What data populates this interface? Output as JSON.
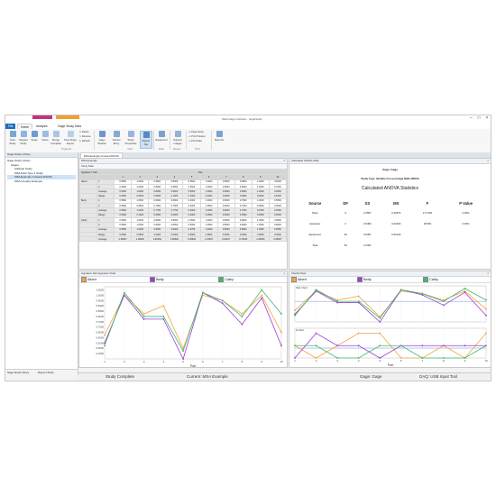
{
  "window": {
    "title": "Multi-Gage Interface - GageStudy",
    "context_tabs": [
      "",
      ""
    ],
    "tabs": [
      {
        "label": "File"
      },
      {
        "label": "Home"
      },
      {
        "label": "Analysis"
      },
      {
        "label": "Gage Study Data"
      }
    ]
  },
  "ribbon": {
    "buttons": [
      "New Study",
      "Repeat Study",
      "Study",
      "Clone",
      "Merge Complete",
      "New Study Export",
      "Gage Studies",
      "Cancel Entry",
      "Study Properties",
      "Report Set",
      "Equipment",
      "Support Images",
      "Reports"
    ],
    "small_items": [
      "Delete",
      "Rename",
      "Refresh",
      "Page Setup",
      "Print Preview",
      "Print Data"
    ],
    "groups": [
      "Organize",
      "View",
      "Data",
      "Report",
      "Print"
    ]
  },
  "sidebar": {
    "header": "Gage Study Library",
    "items": [
      "Study Library",
      "Group By",
      "Sort"
    ],
    "tree": [
      "Gage Study Library",
      "Gages",
      "Attribute Study",
      "MSA Data Type 1 Study",
      "MSA Example Crossed ANOVA",
      "MSA Linearity Example"
    ],
    "bottom_tabs": [
      "Gage Study Library",
      "Report Library"
    ]
  },
  "document": {
    "tabs": [
      "MSA Example Crossed ANOVA"
    ],
    "subtab": "MSA Example"
  },
  "study_data": {
    "header": "Study Data",
    "columns": [
      "Appraiser / Trial",
      "1",
      "2",
      "3",
      "4",
      "5",
      "6",
      "7",
      "8",
      "9",
      "10"
    ],
    "parts_label": "Part",
    "rows": [
      {
        "a": "Albert",
        "t": "1",
        "v": [
          "0.6500",
          "1.0000",
          "0.8500",
          "0.8500",
          "0.5500",
          "1.0000",
          "0.9500",
          "0.8500",
          "1.0000",
          "0.6000"
        ]
      },
      {
        "a": "",
        "t": "2",
        "v": [
          "0.6000",
          "1.0000",
          "0.8000",
          "0.9500",
          "0.4500",
          "1.0000",
          "0.9500",
          "0.8000",
          "1.0000",
          "0.7000"
        ]
      },
      {
        "a": "",
        "t": "Average",
        "v": [
          "0.6250",
          "1.0000",
          "0.8250",
          "0.9000",
          "0.5000",
          "1.0000",
          "0.9500",
          "0.8250",
          "1.0000",
          "0.6500"
        ]
      },
      {
        "a": "",
        "t": "Range",
        "v": [
          "0.0500",
          "0.0000",
          "0.0500",
          "0.1000",
          "0.1000",
          "0.0000",
          "0.0000",
          "0.0500",
          "0.0000",
          "0.1000"
        ]
      },
      {
        "a": "Betty",
        "t": "1",
        "v": [
          "0.5500",
          "1.0500",
          "0.8000",
          "0.8000",
          "0.4000",
          "1.0000",
          "0.9500",
          "0.7500",
          "1.0000",
          "0.5500"
        ]
      },
      {
        "a": "",
        "t": "2",
        "v": [
          "0.5500",
          "0.9500",
          "0.7500",
          "0.7500",
          "0.4000",
          "1.0500",
          "0.9000",
          "0.7000",
          "0.9500",
          "0.5000"
        ]
      },
      {
        "a": "",
        "t": "Average",
        "v": [
          "0.5500",
          "1.0000",
          "0.7750",
          "0.7750",
          "0.4000",
          "1.0250",
          "0.9250",
          "0.7250",
          "0.9750",
          "0.5250"
        ]
      },
      {
        "a": "",
        "t": "Range",
        "v": [
          "0.0000",
          "0.1000",
          "0.0500",
          "0.0500",
          "0.0000",
          "0.0500",
          "0.0500",
          "0.0500",
          "0.0500",
          "0.0500"
        ]
      },
      {
        "a": "Cathy",
        "t": "1",
        "v": [
          "0.5000",
          "1.0500",
          "0.8000",
          "0.8000",
          "0.4500",
          "1.0000",
          "0.9500",
          "0.8000",
          "1.0500",
          "0.8500"
        ]
      },
      {
        "a": "",
        "t": "2",
        "v": [
          "0.5500",
          "1.0000",
          "0.8000",
          "0.8000",
          "0.5000",
          "1.0500",
          "0.9500",
          "0.8000",
          "1.0500",
          "0.8000"
        ]
      },
      {
        "a": "",
        "t": "Average",
        "v": [
          "0.5250",
          "1.0250",
          "0.8000",
          "0.8000",
          "0.4750",
          "1.0250",
          "0.9500",
          "0.8000",
          "1.0500",
          "0.8250"
        ]
      },
      {
        "a": "",
        "t": "Range",
        "v": [
          "0.0500",
          "0.0500",
          "0.0000",
          "0.0000",
          "0.0500",
          "0.0500",
          "0.0000",
          "0.0000",
          "0.0000",
          "0.0500"
        ]
      },
      {
        "a": "",
        "t": "Average",
        "v": [
          "0.56667",
          "1.00833",
          "0.80000",
          "0.82500",
          "0.45833",
          "1.01667",
          "0.94167",
          "0.78333",
          "1.00833",
          "0.66667"
        ]
      }
    ]
  },
  "anova": {
    "header": "Calculated ANOVA Table",
    "gage_line": "Gage: Gage",
    "study_type": "Study Type: Variable Crossed Gage R&R ANOVA",
    "heading": "Calculated ANOVA Statistics",
    "columns": [
      "Source",
      "DF",
      "SS",
      "MS",
      "F",
      "P Value"
    ],
    "rows": [
      [
        "Parts",
        "9",
        "2.0587",
        "0.22875",
        "177.093",
        "0.00%"
      ],
      [
        "Appraiser",
        "2",
        "0.0480",
        "0.02400",
        "18.581",
        "0.00%"
      ],
      [
        "Equipment",
        "30",
        "0.0387",
        "0.00129",
        "",
        ""
      ],
      [
        "Total",
        "59",
        "2.2451",
        "",
        "",
        ""
      ]
    ]
  },
  "legend": [
    "Albert",
    "Betty",
    "Cathy"
  ],
  "colors": {
    "albert": "#f3a541",
    "betty": "#9b3fd1",
    "cathy": "#3fb86c",
    "blue": "#6f8fe0",
    "accent": "#1e6fb8"
  },
  "chart_left": {
    "header": "Appraiser Part Appraiser Chart",
    "xlabel": "Part",
    "y_ticks": [
      "1.0500",
      "1.0000",
      "0.9500",
      "0.9000",
      "0.8500",
      "0.8000",
      "0.7500",
      "0.7000",
      "0.6500",
      "0.6000",
      "0.5500",
      "0.5000",
      "0.4500"
    ],
    "chart_data": {
      "type": "line",
      "x": [
        1,
        2,
        3,
        4,
        5,
        6,
        7,
        8,
        9,
        10
      ],
      "ylim": [
        0.4,
        1.08
      ],
      "series": [
        {
          "name": "Albert",
          "values": [
            0.625,
            1.0,
            0.825,
            0.9,
            0.5,
            1.0,
            0.95,
            0.825,
            1.0,
            0.65
          ]
        },
        {
          "name": "Betty",
          "values": [
            0.55,
            1.0,
            0.775,
            0.775,
            0.4,
            1.025,
            0.925,
            0.725,
            0.975,
            0.525
          ]
        },
        {
          "name": "Cathy",
          "values": [
            0.525,
            1.025,
            0.8,
            0.8,
            0.475,
            1.025,
            0.95,
            0.8,
            1.05,
            0.825
          ]
        }
      ]
    }
  },
  "chart_right": {
    "header": "Xbar/R Chart",
    "top_label": "Xbar Chart",
    "bottom_label": "R Chart",
    "xlabel": "Part",
    "chart_data": [
      {
        "type": "line",
        "x": [
          1,
          2,
          3,
          4,
          5,
          6,
          7,
          8,
          9,
          10
        ],
        "ylim": [
          0.4,
          1.1
        ],
        "series": [
          {
            "name": "Albert",
            "values": [
              0.625,
              1.0,
              0.825,
              0.9,
              0.5,
              1.0,
              0.95,
              0.825,
              1.0,
              0.65
            ]
          },
          {
            "name": "Betty",
            "values": [
              0.55,
              1.0,
              0.775,
              0.775,
              0.4,
              1.025,
              0.925,
              0.725,
              0.975,
              0.525
            ]
          },
          {
            "name": "Cathy",
            "values": [
              0.525,
              1.025,
              0.8,
              0.8,
              0.475,
              1.025,
              0.95,
              0.8,
              1.05,
              0.825
            ]
          }
        ]
      },
      {
        "type": "line",
        "x": [
          1,
          2,
          3,
          4,
          5,
          6,
          7,
          8,
          9,
          10
        ],
        "ylim": [
          0,
          0.12
        ],
        "series": [
          {
            "name": "Albert",
            "values": [
              0.05,
              0.0,
              0.05,
              0.1,
              0.1,
              0.0,
              0.0,
              0.05,
              0.0,
              0.1
            ]
          },
          {
            "name": "Betty",
            "values": [
              0.0,
              0.1,
              0.05,
              0.05,
              0.0,
              0.05,
              0.05,
              0.05,
              0.05,
              0.05
            ]
          },
          {
            "name": "Cathy",
            "values": [
              0.05,
              0.05,
              0.0,
              0.0,
              0.05,
              0.05,
              0.0,
              0.0,
              0.0,
              0.05
            ]
          }
        ]
      }
    ]
  },
  "status": {
    "study": "Study Complete",
    "current": "Current: MSA Example",
    "gage": "Gage: Gage",
    "daq": "DAQ: USB Input Tool"
  }
}
